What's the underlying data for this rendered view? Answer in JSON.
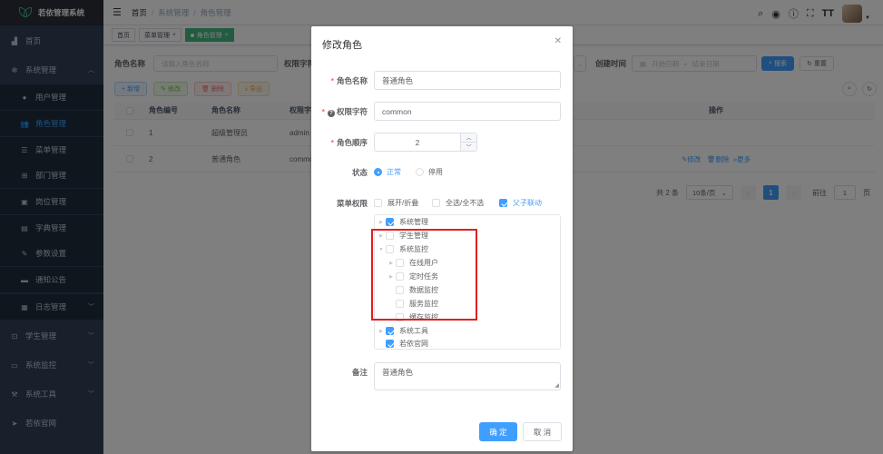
{
  "app": {
    "title": "若依管理系统"
  },
  "sidebar": {
    "items": [
      {
        "label": "首页",
        "icon": "dashboard-icon"
      },
      {
        "label": "系统管理",
        "icon": "gear-icon"
      },
      {
        "label": "用户管理",
        "icon": "user-icon"
      },
      {
        "label": "角色管理",
        "icon": "peoples-icon"
      },
      {
        "label": "菜单管理",
        "icon": "tree-table-icon"
      },
      {
        "label": "部门管理",
        "icon": "tree-icon"
      },
      {
        "label": "岗位管理",
        "icon": "post-icon"
      },
      {
        "label": "字典管理",
        "icon": "dict-icon"
      },
      {
        "label": "参数设置",
        "icon": "edit-icon"
      },
      {
        "label": "通知公告",
        "icon": "message-icon"
      },
      {
        "label": "日志管理",
        "icon": "log-icon"
      },
      {
        "label": "学生管理",
        "icon": "car-icon"
      },
      {
        "label": "系统监控",
        "icon": "monitor-icon"
      },
      {
        "label": "系统工具",
        "icon": "tool-icon"
      },
      {
        "label": "若依官网",
        "icon": "guide-icon"
      }
    ]
  },
  "navbar": {
    "breadcrumb": [
      "首页",
      "系统管理",
      "角色管理"
    ]
  },
  "tags": [
    {
      "label": "首页"
    },
    {
      "label": "菜单管理"
    },
    {
      "label": "角色管理"
    }
  ],
  "search_form": {
    "role_name_label": "角色名称",
    "role_name_placeholder": "请输入角色名称",
    "perm_label": "权限字符",
    "create_time_label": "创建时间",
    "start_date": "开始日期",
    "range_sep": "-",
    "end_date": "结束日期",
    "search_btn": "搜索",
    "reset_btn": "重置"
  },
  "toolbar": {
    "add": "新增",
    "edit": "修改",
    "delete": "删除",
    "export": "导出"
  },
  "table": {
    "headers": {
      "id": "角色编号",
      "name": "角色名称",
      "perm": "权限字",
      "ops": "操作"
    },
    "rows": [
      {
        "id": "1",
        "name": "超级管理员",
        "perm": "admin"
      },
      {
        "id": "2",
        "name": "普通角色",
        "perm": "commo"
      }
    ],
    "row_actions": {
      "edit": "修改",
      "delete": "删除",
      "more": "更多"
    }
  },
  "pagination": {
    "total": "共 2 条",
    "page_size": "10条/页",
    "current": "1",
    "goto_label": "前往",
    "goto_value": "1",
    "page_suffix": "页"
  },
  "dialog": {
    "title": "修改角色",
    "role_name_label": "角色名称",
    "role_name_value": "普通角色",
    "perm_label": "权限字符",
    "perm_value": "common",
    "order_label": "角色顺序",
    "order_value": "2",
    "status_label": "状态",
    "status_options": [
      "正常",
      "停用"
    ],
    "menu_perm_label": "菜单权限",
    "menu_checks": [
      {
        "label": "展开/折叠",
        "checked": false
      },
      {
        "label": "全选/全不选",
        "checked": false
      },
      {
        "label": "父子联动",
        "checked": true
      }
    ],
    "tree": [
      {
        "label": "系统管理",
        "checked": true
      },
      {
        "label": "学生管理",
        "checked": false
      },
      {
        "label": "系统监控",
        "checked": false
      },
      {
        "label": "在线用户",
        "checked": false
      },
      {
        "label": "定时任务",
        "checked": false
      },
      {
        "label": "数据监控",
        "checked": false
      },
      {
        "label": "服务监控",
        "checked": false
      },
      {
        "label": "缓存监控",
        "checked": false
      },
      {
        "label": "系统工具",
        "checked": true
      },
      {
        "label": "若依官网",
        "checked": true
      }
    ],
    "remark_label": "备注",
    "remark_value": "普通角色",
    "confirm": "确 定",
    "cancel": "取 消"
  },
  "colors": {
    "primary": "#409eff",
    "sidebar_bg": "#304156",
    "highlight_box": "#e02020",
    "tag_active": "#42b983"
  }
}
